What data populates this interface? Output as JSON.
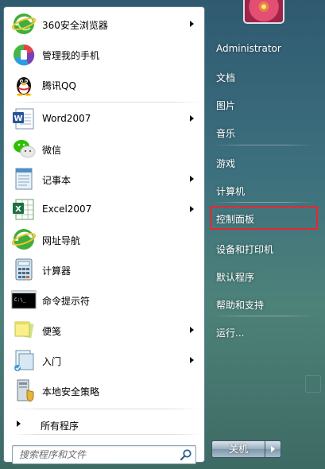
{
  "start_menu": {
    "pinned_programs": [
      {
        "label": "360安全浏览器",
        "icon": "360-browser-icon",
        "has_submenu": true
      },
      {
        "label": "管理我的手机",
        "icon": "phone-manager-icon",
        "has_submenu": false
      },
      {
        "label": "腾讯QQ",
        "icon": "qq-penguin-icon",
        "has_submenu": false
      }
    ],
    "recent_programs": [
      {
        "label": "Word2007",
        "icon": "word-icon",
        "has_submenu": true
      },
      {
        "label": "微信",
        "icon": "wechat-icon",
        "has_submenu": false
      },
      {
        "label": "记事本",
        "icon": "notepad-icon",
        "has_submenu": true
      },
      {
        "label": "Excel2007",
        "icon": "excel-icon",
        "has_submenu": true
      },
      {
        "label": "网址导航",
        "icon": "web-nav-icon",
        "has_submenu": false
      },
      {
        "label": "计算器",
        "icon": "calculator-icon",
        "has_submenu": false
      },
      {
        "label": "命令提示符",
        "icon": "cmd-icon",
        "has_submenu": false
      },
      {
        "label": "便笺",
        "icon": "sticky-notes-icon",
        "has_submenu": true
      },
      {
        "label": "入门",
        "icon": "getting-started-icon",
        "has_submenu": true
      },
      {
        "label": "本地安全策略",
        "icon": "security-policy-icon",
        "has_submenu": false
      }
    ],
    "all_programs_label": "所有程序",
    "search": {
      "placeholder": "搜索程序和文件"
    },
    "right_panel": {
      "user_name": "Administrator",
      "items": [
        "文档",
        "图片",
        "音乐",
        "游戏",
        "计算机",
        "控制面板",
        "设备和打印机",
        "默认程序",
        "帮助和支持",
        "运行..."
      ],
      "highlighted_item": "控制面板"
    },
    "shutdown": {
      "label": "关机"
    },
    "colors": {
      "highlight_border": "#e8262f",
      "right_text": "#ffffff",
      "left_background": "#ffffff"
    }
  }
}
